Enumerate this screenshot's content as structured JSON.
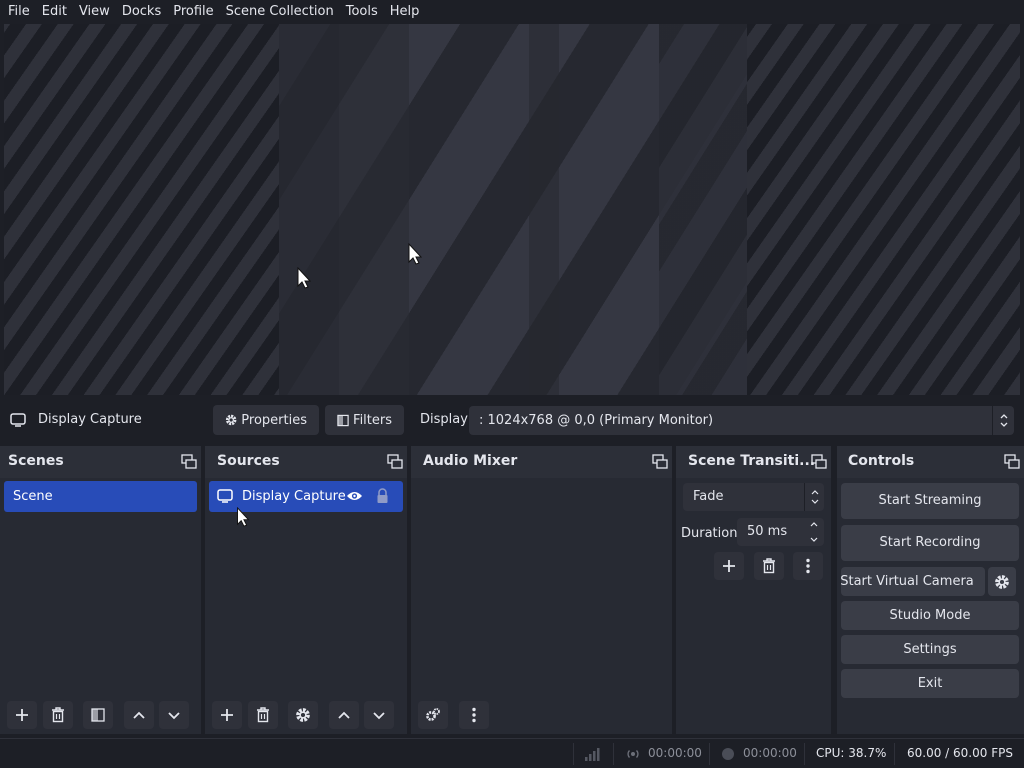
{
  "menu": [
    "File",
    "Edit",
    "View",
    "Docks",
    "Profile",
    "Scene Collection",
    "Tools",
    "Help"
  ],
  "source_toolbar": {
    "source_name": "Display Capture",
    "properties_label": "Properties",
    "filters_label": "Filters",
    "display_label": "Display",
    "display_value": ": 1024x768 @ 0,0 (Primary Monitor)"
  },
  "docks": {
    "scenes": {
      "title": "Scenes",
      "items": [
        "Scene"
      ]
    },
    "sources": {
      "title": "Sources",
      "items": [
        "Display Capture"
      ]
    },
    "audio_mixer": {
      "title": "Audio Mixer"
    },
    "transitions": {
      "title": "Scene Transiti...",
      "transition_value": "Fade",
      "duration_label": "Duration",
      "duration_value": "50 ms"
    },
    "controls": {
      "title": "Controls",
      "start_streaming": "Start Streaming",
      "start_recording": "Start Recording",
      "start_virtual_camera": "Start Virtual Camera",
      "studio_mode": "Studio Mode",
      "settings": "Settings",
      "exit": "Exit"
    }
  },
  "status": {
    "stream_time": "00:00:00",
    "record_time": "00:00:00",
    "cpu": "CPU: 38.7%",
    "fps": "60.00 / 60.00 FPS"
  },
  "colors": {
    "background": "#1d1f26",
    "dock": "#272a33",
    "selection": "#284cb8",
    "button": "#3a3d47"
  },
  "icons": [
    "monitor-icon",
    "gear-icon",
    "filter-icon",
    "float-icon",
    "plus-icon",
    "trash-icon",
    "up-icon",
    "down-icon",
    "eye-icon",
    "lock-icon",
    "more-icon",
    "signal-icon",
    "record-dot-icon",
    "cursor-icon"
  ]
}
